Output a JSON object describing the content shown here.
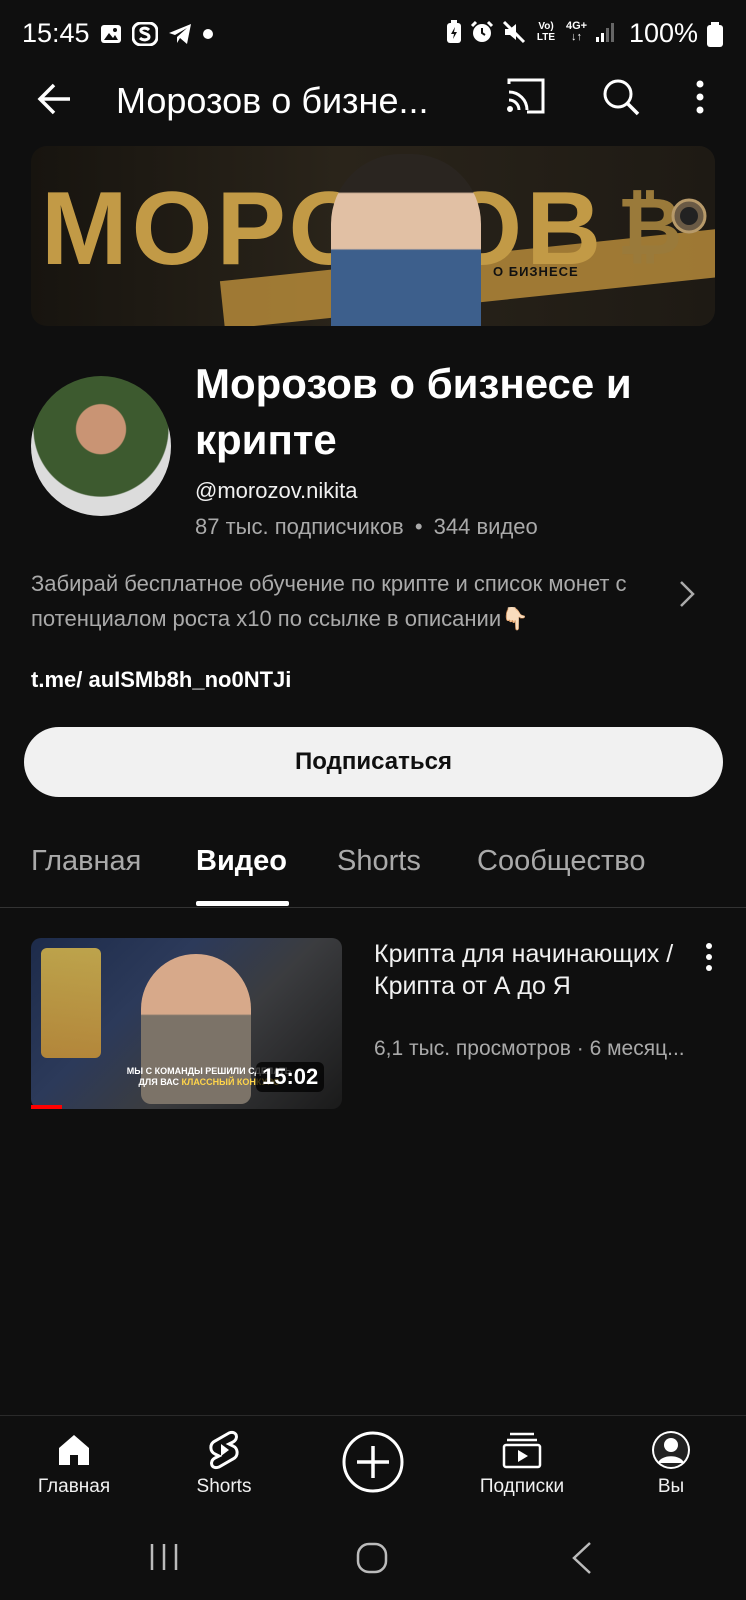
{
  "status_bar": {
    "time": "15:45",
    "battery": "100%",
    "left_icons": [
      "image-icon",
      "s-app-icon",
      "telegram-icon",
      "dot-icon"
    ],
    "right_icons": [
      "battery-saver-icon",
      "alarm-icon",
      "mute-icon",
      "volte-icon",
      "4g-icon",
      "signal-icon",
      "battery-icon"
    ],
    "volte_label": "Vo) LTE",
    "network_label": "4G+"
  },
  "top_bar": {
    "title": "Морозов о бизне..."
  },
  "banner": {
    "text": "МОРОЗОВ",
    "subtitle": "О БИЗНЕСЕ"
  },
  "channel": {
    "name": "Морозов о бизнесе и крипте",
    "handle": "@morozov.nikita",
    "subscribers": "87 тыс. подписчиков",
    "separator": "•",
    "videos": "344 видео",
    "description": "Забирай бесплатное обучение по крипте и список монет с потенциалом роста х10 по ссылке в описании👇🏻",
    "link": "t.me/ auISMb8h_no0NTJi",
    "subscribe_label": "Подписаться"
  },
  "tabs": [
    {
      "label": "Главная",
      "active": false
    },
    {
      "label": "Видео",
      "active": true
    },
    {
      "label": "Shorts",
      "active": false
    },
    {
      "label": "Сообщество",
      "active": false
    }
  ],
  "videos": [
    {
      "title": "Крипта для начинающих / Крипта от А до Я",
      "meta": "6,1 тыс. просмотров · 6 месяц...",
      "duration": "15:02",
      "thumb_caption_1": "МЫ С КОМАНДЫ РЕШИЛИ СДЕЛАТЬ",
      "thumb_caption_2": "ДЛЯ ВАС",
      "thumb_caption_highlight": "КЛАССНЫЙ КОНКУРС",
      "watched_fraction": 0.1
    }
  ],
  "bottom_nav": [
    {
      "label": "Главная",
      "icon": "home-icon"
    },
    {
      "label": "Shorts",
      "icon": "shorts-icon"
    },
    {
      "label": "",
      "icon": "create-icon"
    },
    {
      "label": "Подписки",
      "icon": "subscriptions-icon"
    },
    {
      "label": "Вы",
      "icon": "account-icon"
    }
  ],
  "colors": {
    "background": "#0f0f0f",
    "text": "#f1f1f1",
    "secondary_text": "#aaaaaa",
    "accent_red": "#ff0000"
  }
}
